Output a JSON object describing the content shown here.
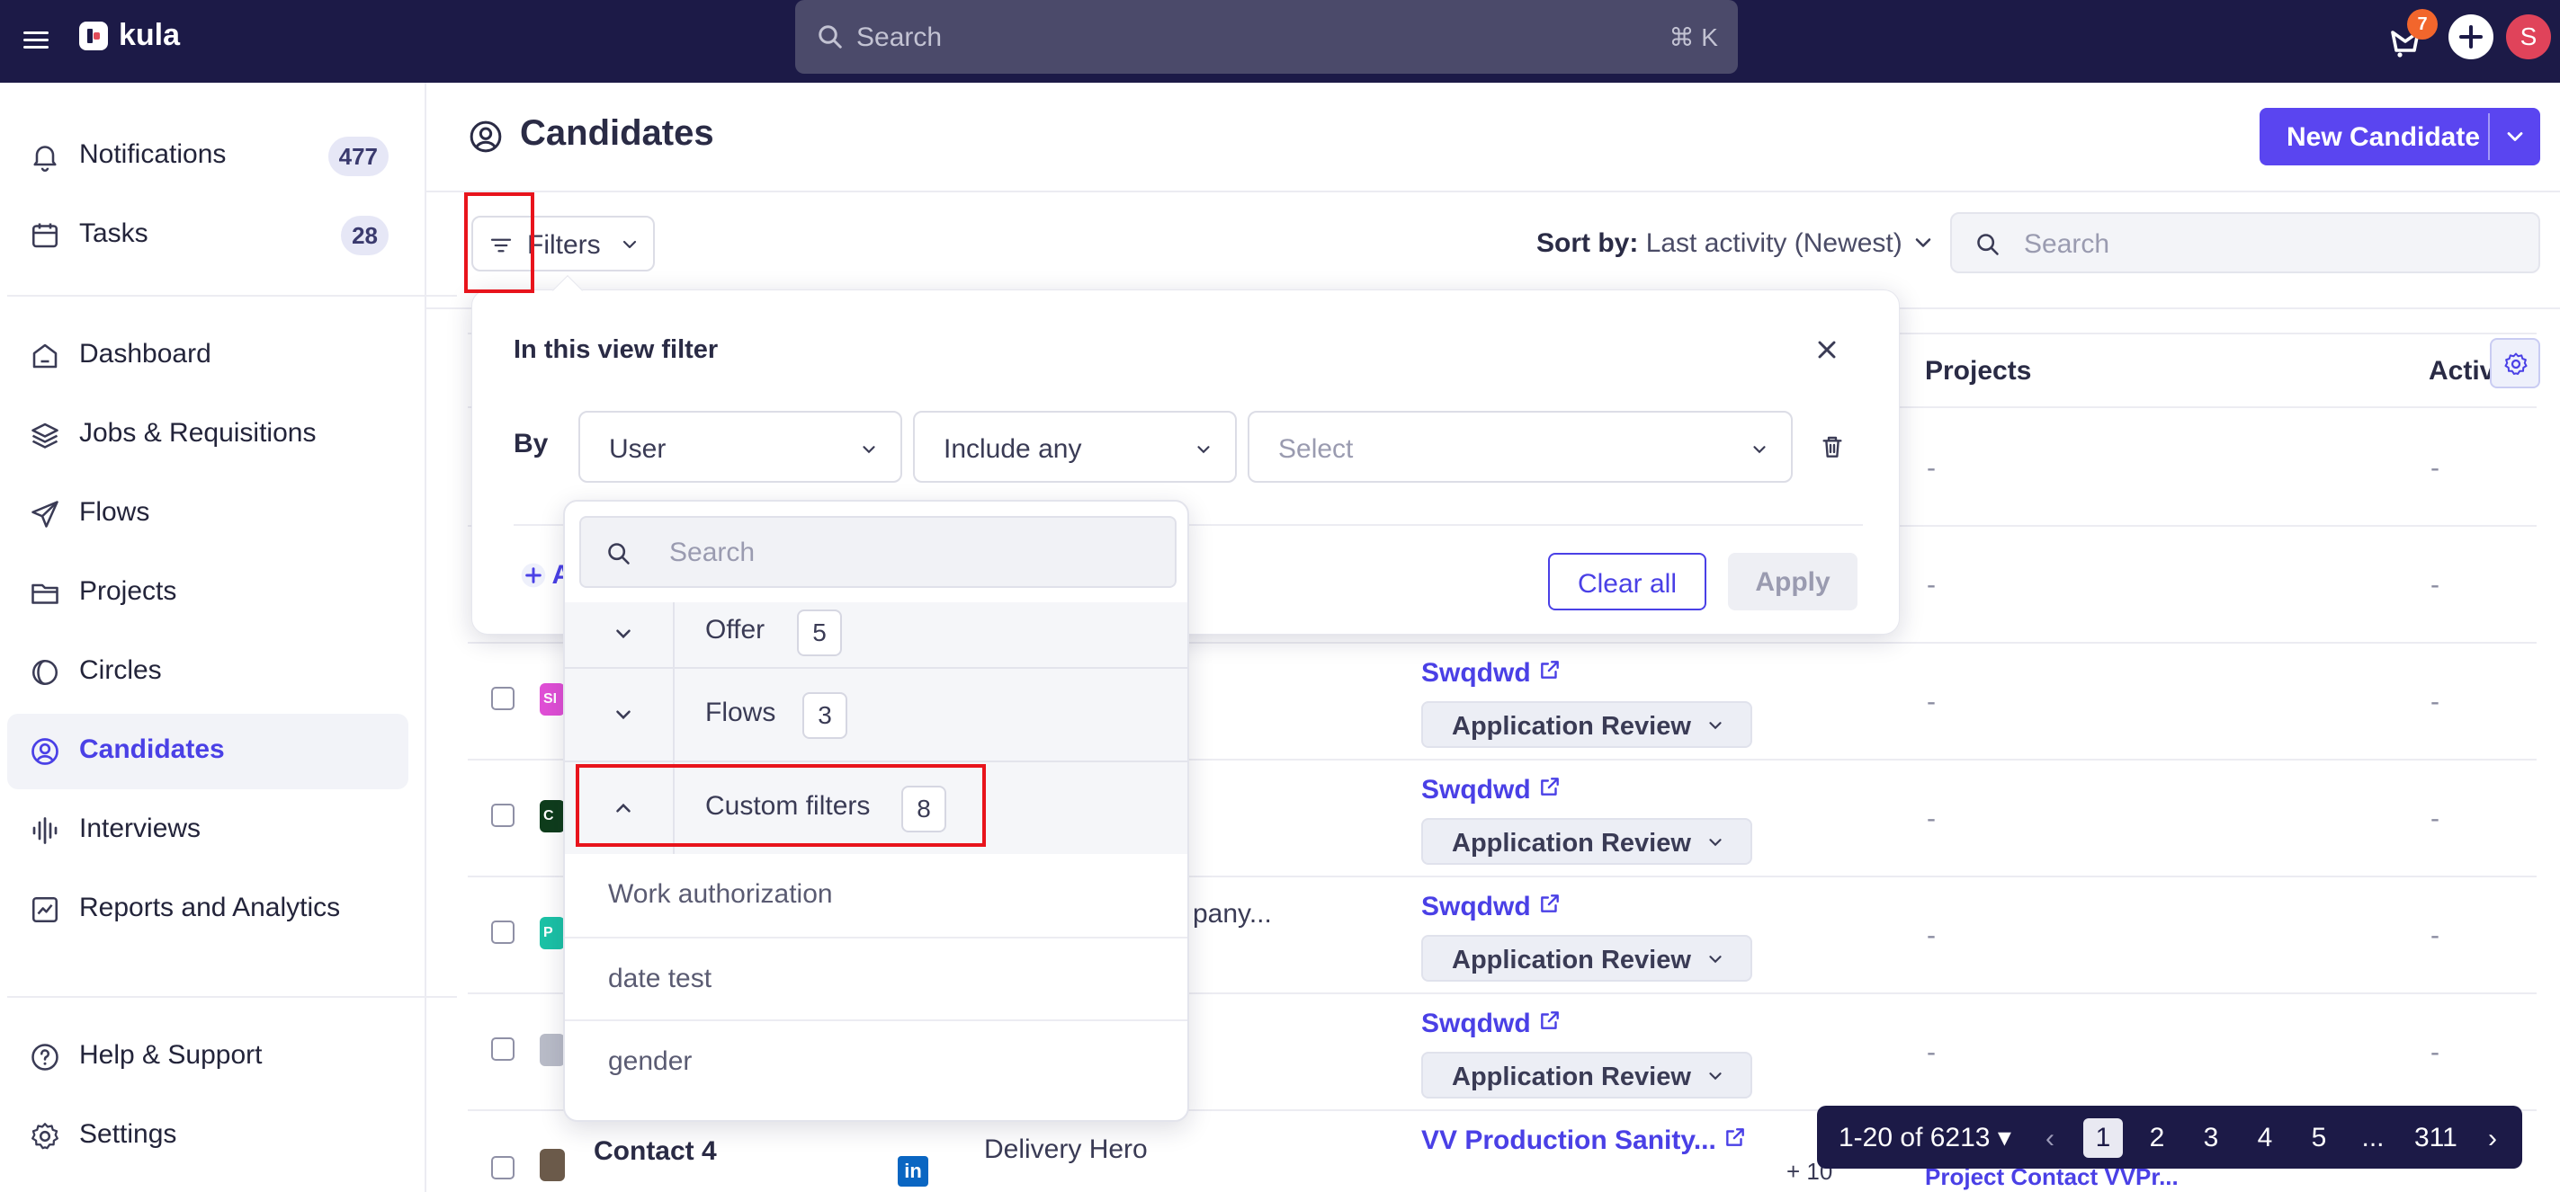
{
  "app": {
    "name": "kula"
  },
  "topbar": {
    "search_placeholder": "Search",
    "shortcut": "⌘ K",
    "notification_count": "7",
    "avatar_initial": "S"
  },
  "sidebar": {
    "items": [
      {
        "label": "Notifications",
        "badge": "477"
      },
      {
        "label": "Tasks",
        "badge": "28"
      },
      {
        "label": "Dashboard"
      },
      {
        "label": "Jobs & Requisitions"
      },
      {
        "label": "Flows"
      },
      {
        "label": "Projects"
      },
      {
        "label": "Circles"
      },
      {
        "label": "Candidates"
      },
      {
        "label": "Interviews"
      },
      {
        "label": "Reports and Analytics"
      },
      {
        "label": "Help & Support"
      },
      {
        "label": "Settings"
      }
    ]
  },
  "page": {
    "title": "Candidates",
    "new_button": "New Candidate",
    "filters_label": "Filters",
    "sort_prefix": "Sort by:",
    "sort_value": "Last activity (Newest)",
    "search_placeholder": "Search"
  },
  "table": {
    "headers": {
      "projects": "Projects",
      "activity": "Activi"
    },
    "dash": "-",
    "rows": [
      {
        "avatar_text": "SI",
        "avatar_color": "#e04fd6",
        "link": "Swqdwd",
        "stage": "Application Review"
      },
      {
        "avatar_text": "C",
        "avatar_color": "#0f3d1c",
        "link": "Swqdwd",
        "stage": "Application Review"
      },
      {
        "avatar_text": "P",
        "avatar_color": "#1bc2a6",
        "company": "pany...",
        "link": "Swqdwd",
        "stage": "Application Review"
      },
      {
        "avatar_text": "",
        "avatar_color": "#b9bcc8",
        "link": "Swqdwd",
        "stage": "Application Review"
      },
      {
        "name": "Contact 4",
        "company": "Delivery Hero",
        "link": "VV Production Sanity...",
        "extra": "+ 10",
        "link2": "Project Contact VVPr..."
      }
    ]
  },
  "filter_panel": {
    "title": "In this view filter",
    "by_label": "By",
    "field": "User",
    "operator": "Include any",
    "value_placeholder": "Select",
    "add_label": "A",
    "clear_all": "Clear all",
    "apply": "Apply"
  },
  "user_dropdown": {
    "search_placeholder": "Search",
    "groups": [
      {
        "label": "Offer",
        "count": "5"
      },
      {
        "label": "Flows",
        "count": "3"
      },
      {
        "label": "Custom filters",
        "count": "8"
      }
    ],
    "options": [
      "Work authorization",
      "date test",
      "gender"
    ]
  },
  "pagination": {
    "range": "1-20 of 6213",
    "pages": [
      "1",
      "2",
      "3",
      "4",
      "5",
      "...",
      "311"
    ],
    "current": "1"
  },
  "colors": {
    "topbar": "#1c1a47",
    "accent": "#5a45f0",
    "highlight": "#e8141c"
  }
}
